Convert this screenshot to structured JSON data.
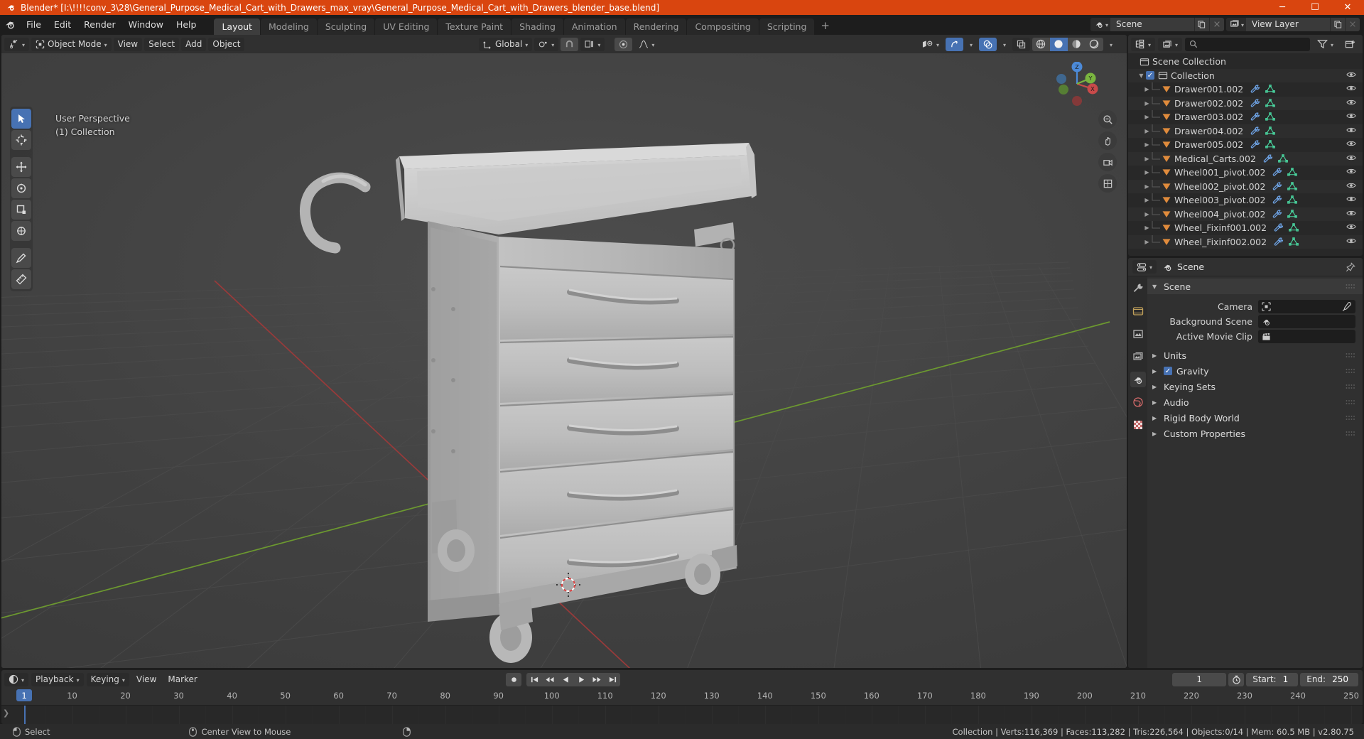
{
  "window": {
    "title": "Blender* [I:\\!!!!conv_3\\28\\General_Purpose_Medical_Cart_with_Drawers_max_vray\\General_Purpose_Medical_Cart_with_Drawers_blender_base.blend]",
    "minimize": "─",
    "maximize": "☐",
    "close": "✕"
  },
  "menus": [
    {
      "label": "File"
    },
    {
      "label": "Edit"
    },
    {
      "label": "Render"
    },
    {
      "label": "Window"
    },
    {
      "label": "Help"
    }
  ],
  "workspace_tabs": [
    {
      "label": "Layout",
      "active": true
    },
    {
      "label": "Modeling",
      "active": false
    },
    {
      "label": "Sculpting",
      "active": false
    },
    {
      "label": "UV Editing",
      "active": false
    },
    {
      "label": "Texture Paint",
      "active": false
    },
    {
      "label": "Shading",
      "active": false
    },
    {
      "label": "Animation",
      "active": false
    },
    {
      "label": "Rendering",
      "active": false
    },
    {
      "label": "Compositing",
      "active": false
    },
    {
      "label": "Scripting",
      "active": false
    }
  ],
  "workspace_add": "+",
  "topbar_right": {
    "scene_name": "Scene",
    "view_layer_name": "View Layer"
  },
  "viewport": {
    "mode": "Object Mode",
    "menus": [
      "View",
      "Select",
      "Add",
      "Object"
    ],
    "transform_orientation": "Global",
    "overlay_line1": "User Perspective",
    "overlay_line2": "(1) Collection",
    "gizmo_axes": {
      "x": "X",
      "y": "Y",
      "z": "Z"
    }
  },
  "outliner": {
    "search_placeholder": "",
    "rows": [
      {
        "label": "Scene Collection",
        "indent": 0,
        "icon": "collection-icon",
        "expand": "",
        "check": false,
        "modifier": false,
        "mesh": false,
        "eye": false
      },
      {
        "label": "Collection",
        "indent": 1,
        "icon": "collection-icon",
        "expand": "▼",
        "check": true,
        "modifier": false,
        "mesh": false,
        "eye": true
      },
      {
        "label": "Drawer001.002",
        "indent": 2,
        "icon": "object-icon",
        "expand": "▶",
        "check": false,
        "modifier": true,
        "mesh": true,
        "eye": true
      },
      {
        "label": "Drawer002.002",
        "indent": 2,
        "icon": "object-icon",
        "expand": "▶",
        "check": false,
        "modifier": true,
        "mesh": true,
        "eye": true
      },
      {
        "label": "Drawer003.002",
        "indent": 2,
        "icon": "object-icon",
        "expand": "▶",
        "check": false,
        "modifier": true,
        "mesh": true,
        "eye": true
      },
      {
        "label": "Drawer004.002",
        "indent": 2,
        "icon": "object-icon",
        "expand": "▶",
        "check": false,
        "modifier": true,
        "mesh": true,
        "eye": true
      },
      {
        "label": "Drawer005.002",
        "indent": 2,
        "icon": "object-icon",
        "expand": "▶",
        "check": false,
        "modifier": true,
        "mesh": true,
        "eye": true
      },
      {
        "label": "Medical_Carts.002",
        "indent": 2,
        "icon": "object-icon",
        "expand": "▶",
        "check": false,
        "modifier": true,
        "mesh": true,
        "eye": true
      },
      {
        "label": "Wheel001_pivot.002",
        "indent": 2,
        "icon": "object-icon",
        "expand": "▶",
        "check": false,
        "modifier": true,
        "mesh": true,
        "eye": true
      },
      {
        "label": "Wheel002_pivot.002",
        "indent": 2,
        "icon": "object-icon",
        "expand": "▶",
        "check": false,
        "modifier": true,
        "mesh": true,
        "eye": true
      },
      {
        "label": "Wheel003_pivot.002",
        "indent": 2,
        "icon": "object-icon",
        "expand": "▶",
        "check": false,
        "modifier": true,
        "mesh": true,
        "eye": true
      },
      {
        "label": "Wheel004_pivot.002",
        "indent": 2,
        "icon": "object-icon",
        "expand": "▶",
        "check": false,
        "modifier": true,
        "mesh": true,
        "eye": true
      },
      {
        "label": "Wheel_Fixinf001.002",
        "indent": 2,
        "icon": "object-icon",
        "expand": "▶",
        "check": false,
        "modifier": true,
        "mesh": true,
        "eye": true
      },
      {
        "label": "Wheel_Fixinf002.002",
        "indent": 2,
        "icon": "object-icon",
        "expand": "▶",
        "check": false,
        "modifier": true,
        "mesh": true,
        "eye": true
      }
    ]
  },
  "properties": {
    "breadcrumb": "Scene",
    "panels": {
      "scene": {
        "label": "Scene",
        "open": true
      },
      "units": {
        "label": "Units",
        "open": false
      },
      "gravity": {
        "label": "Gravity",
        "open": false,
        "checked": true
      },
      "keying_sets": {
        "label": "Keying Sets",
        "open": false
      },
      "audio": {
        "label": "Audio",
        "open": false
      },
      "rigid_body_world": {
        "label": "Rigid Body World",
        "open": false
      },
      "custom_properties": {
        "label": "Custom Properties",
        "open": false
      }
    },
    "fields": [
      {
        "label": "Camera",
        "value": "",
        "icon": "camera-icon",
        "eyedropper": true
      },
      {
        "label": "Background Scene",
        "value": "",
        "icon": "scene-icon",
        "eyedropper": false
      },
      {
        "label": "Active Movie Clip",
        "value": "",
        "icon": "clip-icon",
        "eyedropper": false
      }
    ]
  },
  "timeline": {
    "menus": [
      "Playback",
      "Keying",
      "View",
      "Marker"
    ],
    "current_frame": "1",
    "start_label": "Start:",
    "start_value": "1",
    "end_label": "End:",
    "end_value": "250",
    "ticks": [
      {
        "label": "1",
        "frame": 1,
        "playhead": true
      },
      {
        "label": "10",
        "frame": 10
      },
      {
        "label": "20",
        "frame": 20
      },
      {
        "label": "30",
        "frame": 30
      },
      {
        "label": "40",
        "frame": 40
      },
      {
        "label": "50",
        "frame": 50
      },
      {
        "label": "60",
        "frame": 60
      },
      {
        "label": "70",
        "frame": 70
      },
      {
        "label": "80",
        "frame": 80
      },
      {
        "label": "90",
        "frame": 90
      },
      {
        "label": "100",
        "frame": 100
      },
      {
        "label": "110",
        "frame": 110
      },
      {
        "label": "120",
        "frame": 120
      },
      {
        "label": "130",
        "frame": 130
      },
      {
        "label": "140",
        "frame": 140
      },
      {
        "label": "150",
        "frame": 150
      },
      {
        "label": "160",
        "frame": 160
      },
      {
        "label": "170",
        "frame": 170
      },
      {
        "label": "180",
        "frame": 180
      },
      {
        "label": "190",
        "frame": 190
      },
      {
        "label": "200",
        "frame": 200
      },
      {
        "label": "210",
        "frame": 210
      },
      {
        "label": "220",
        "frame": 220
      },
      {
        "label": "230",
        "frame": 230
      },
      {
        "label": "240",
        "frame": 240
      },
      {
        "label": "250",
        "frame": 250
      }
    ]
  },
  "statusbar": {
    "left_action": "Select",
    "middle_action": "Center View to Mouse",
    "stats": "Collection | Verts:116,369 | Faces:113,282 | Tris:226,564 | Objects:0/14 | Mem: 60.5 MB | v2.80.75"
  },
  "colors": {
    "accent_blue": "#4772b3",
    "title_orange": "#d9450f",
    "object_orange": "#e08b3c",
    "mesh_green": "#4ad6a0",
    "modifier_blue": "#6fa5e8"
  }
}
